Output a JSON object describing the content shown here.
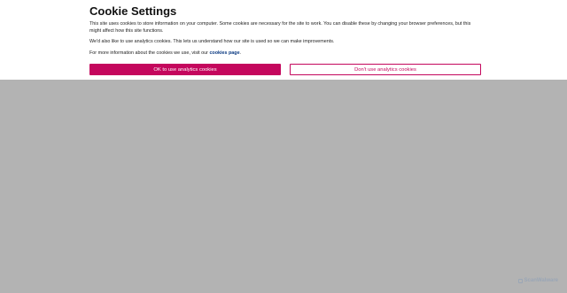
{
  "cookie_banner": {
    "title": "Cookie Settings",
    "paragraph1": "This site uses cookies to store information on your computer. Some cookies are necessary for the site to work. You can disable these by changing your browser preferences, but this might affect how this site functions.",
    "paragraph2": "We'd also like to use analytics cookies. This lets us understand how our site is used so we can make improvements.",
    "paragraph3_prefix": "For more information about the cookies we use, visit our ",
    "paragraph3_link": "cookies page",
    "paragraph3_suffix": ".",
    "accept_label": "OK to use analytics cookies",
    "reject_label": "Don't use analytics cookies"
  },
  "watermark": {
    "text": "ScanWalware"
  },
  "colors": {
    "accent": "#c4075d",
    "overlay": "#b3b3b3",
    "link": "#0b3a82"
  }
}
